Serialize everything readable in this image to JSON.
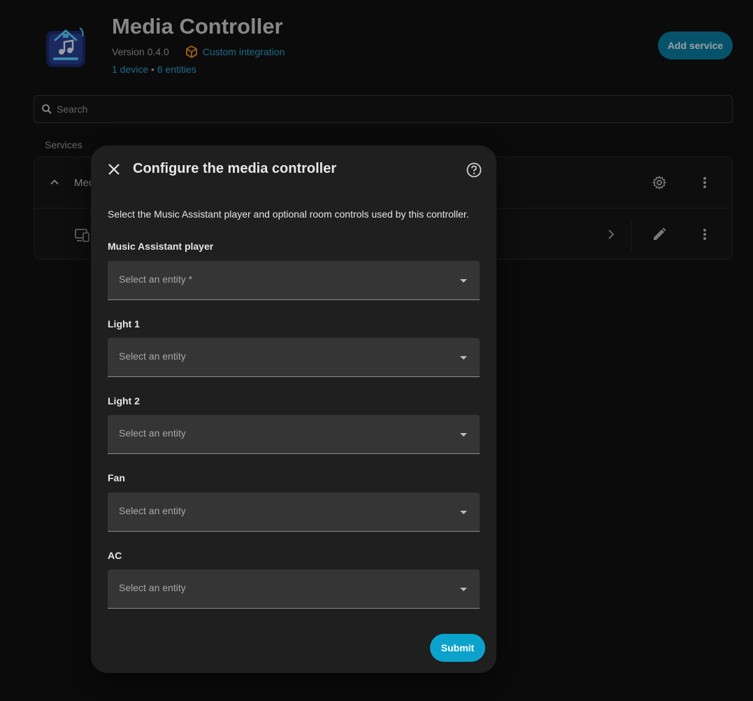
{
  "header": {
    "title": "Media Controller",
    "version": "Version 0.4.0",
    "badge": "Custom integration",
    "devices_link": "1 device",
    "separator": "•",
    "entities_link": "6 entities",
    "add_service_label": "Add service"
  },
  "search": {
    "placeholder": "Search"
  },
  "services": {
    "section_label": "Services",
    "row_name": "Med"
  },
  "dialog": {
    "title": "Configure the media controller",
    "description": "Select the Music Assistant player and optional room controls used by this controller.",
    "fields": [
      {
        "label": "Music Assistant player",
        "placeholder": "Select an entity *"
      },
      {
        "label": "Light 1",
        "placeholder": "Select an entity"
      },
      {
        "label": "Light 2",
        "placeholder": "Select an entity"
      },
      {
        "label": "Fan",
        "placeholder": "Select an entity"
      },
      {
        "label": "AC",
        "placeholder": "Select an entity"
      }
    ],
    "submit_label": "Submit"
  },
  "colors": {
    "accent": "#03a9d4",
    "link": "#2fa7d9",
    "badge_icon": "#e08a1e",
    "dialog_bg": "#1f1f1f",
    "field_bg": "#353535"
  },
  "icons": [
    "app-logo",
    "cube-icon",
    "search-icon",
    "chevron-up-icon",
    "gear-icon",
    "more-vert-icon",
    "device-icon",
    "chevron-right-icon",
    "pencil-icon",
    "close-icon",
    "help-icon",
    "dropdown-caret-icon"
  ]
}
